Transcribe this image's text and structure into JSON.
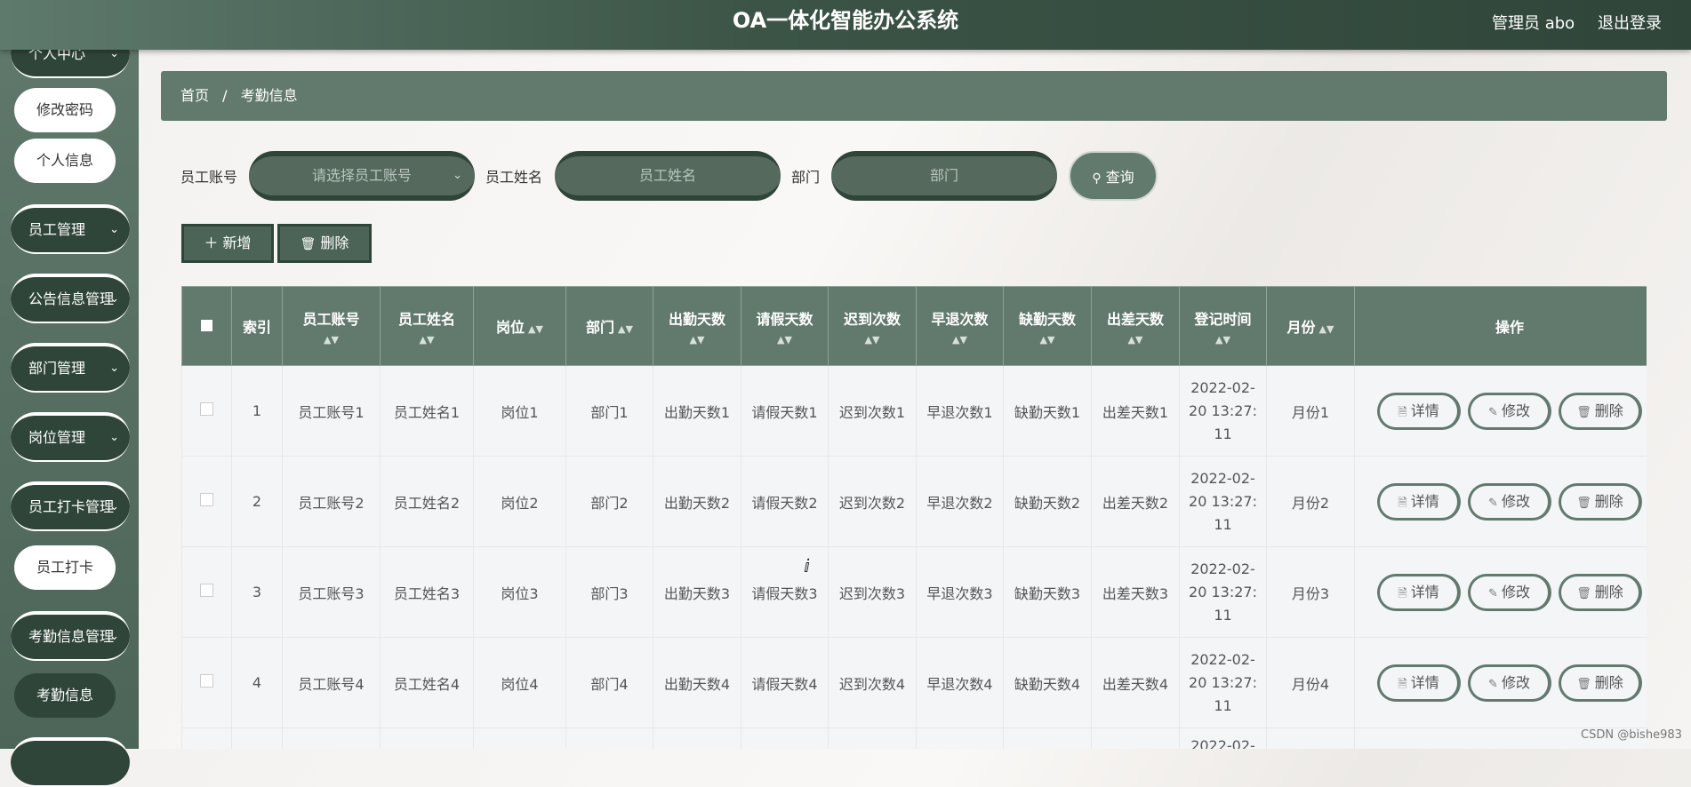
{
  "header": {
    "title": "OA一体化智能办公系统",
    "admin": "管理员 abo",
    "logout": "退出登录"
  },
  "sidebar": {
    "items": [
      {
        "label": "个人中心",
        "chevron": "chevron-down-icon"
      },
      {
        "label": "员工管理",
        "chevron": "chevron-down-icon"
      },
      {
        "label": "公告信息管理",
        "chevron": "chevron-down-icon"
      },
      {
        "label": "部门管理",
        "chevron": "chevron-down-icon"
      },
      {
        "label": "岗位管理",
        "chevron": "chevron-down-icon"
      },
      {
        "label": "员工打卡管理",
        "chevron": "chevron-down-icon"
      },
      {
        "label": "考勤信息管理",
        "chevron": "chevron-down-icon"
      }
    ],
    "subitems": [
      {
        "label": "修改密码"
      },
      {
        "label": "个人信息"
      },
      {
        "label": "员工打卡"
      },
      {
        "label": "考勤信息"
      }
    ]
  },
  "breadcrumb": {
    "home": "首页",
    "sep": "/",
    "current": "考勤信息"
  },
  "search": {
    "account_label": "员工账号",
    "account_placeholder": "请选择员工账号",
    "name_label": "员工姓名",
    "name_placeholder": "员工姓名",
    "dept_label": "部门",
    "dept_placeholder": "部门",
    "query": "查询"
  },
  "actions": {
    "add": "新增",
    "delete": "删除"
  },
  "table": {
    "headers": [
      "索引",
      "员工账号",
      "员工姓名",
      "岗位",
      "部门",
      "出勤天数",
      "请假天数",
      "迟到次数",
      "早退次数",
      "缺勤天数",
      "出差天数",
      "登记时间",
      "月份",
      "操作"
    ],
    "rows": [
      [
        "1",
        "员工账号1",
        "员工姓名1",
        "岗位1",
        "部门1",
        "出勤天数1",
        "请假天数1",
        "迟到次数1",
        "早退次数1",
        "缺勤天数1",
        "出差天数1",
        "2022-02-20 13:27:11",
        "月份1"
      ],
      [
        "2",
        "员工账号2",
        "员工姓名2",
        "岗位2",
        "部门2",
        "出勤天数2",
        "请假天数2",
        "迟到次数2",
        "早退次数2",
        "缺勤天数2",
        "出差天数2",
        "2022-02-20 13:27:11",
        "月份2"
      ],
      [
        "3",
        "员工账号3",
        "员工姓名3",
        "岗位3",
        "部门3",
        "出勤天数3",
        "请假天数3",
        "迟到次数3",
        "早退次数3",
        "缺勤天数3",
        "出差天数3",
        "2022-02-20 13:27:11",
        "月份3"
      ],
      [
        "4",
        "员工账号4",
        "员工姓名4",
        "岗位4",
        "部门4",
        "出勤天数4",
        "请假天数4",
        "迟到次数4",
        "早退次数4",
        "缺勤天数4",
        "出差天数4",
        "2022-02-20 13:27:11",
        "月份4"
      ]
    ],
    "partial_row_time": "2022-02-",
    "op_labels": {
      "detail": "详情",
      "edit": "修改",
      "delete": "删除"
    }
  },
  "watermark": "CSDN @bishe983"
}
